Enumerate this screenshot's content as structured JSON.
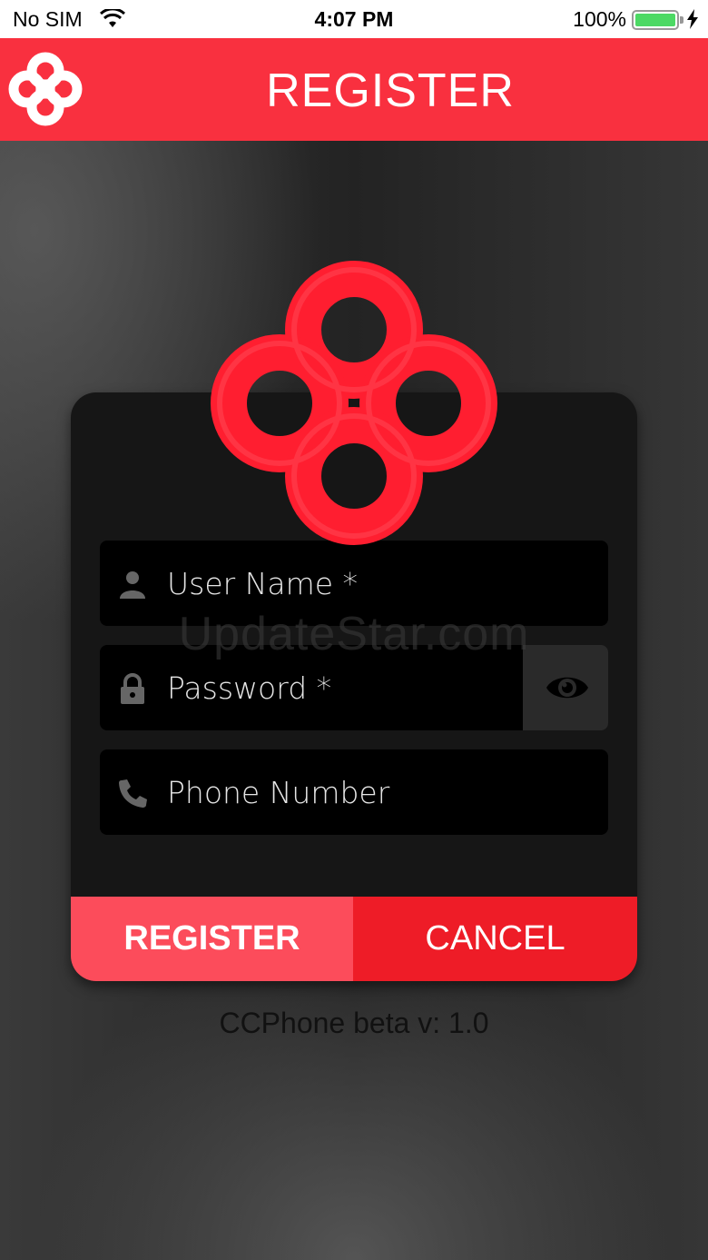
{
  "status_bar": {
    "carrier": "No SIM",
    "time": "4:07 PM",
    "battery": "100%",
    "battery_level": 1.0
  },
  "header": {
    "title": "REGISTER",
    "logo": "app-logo"
  },
  "form": {
    "username_placeholder": "User Name *",
    "password_placeholder": "Password *",
    "phone_placeholder": "Phone Number",
    "username_icon": "person-icon",
    "password_icon": "lock-icon",
    "phone_icon": "phone-icon",
    "show_password_icon": "eye-icon"
  },
  "buttons": {
    "register": "REGISTER",
    "cancel": "CANCEL"
  },
  "watermark": "UpdateStar.com",
  "version": "CCPhone beta v: 1.0",
  "colors": {
    "brand_red": "#f9303f",
    "register_button": "#fc4c5b",
    "cancel_button": "#ee1c27",
    "battery_green": "#4cd964"
  }
}
